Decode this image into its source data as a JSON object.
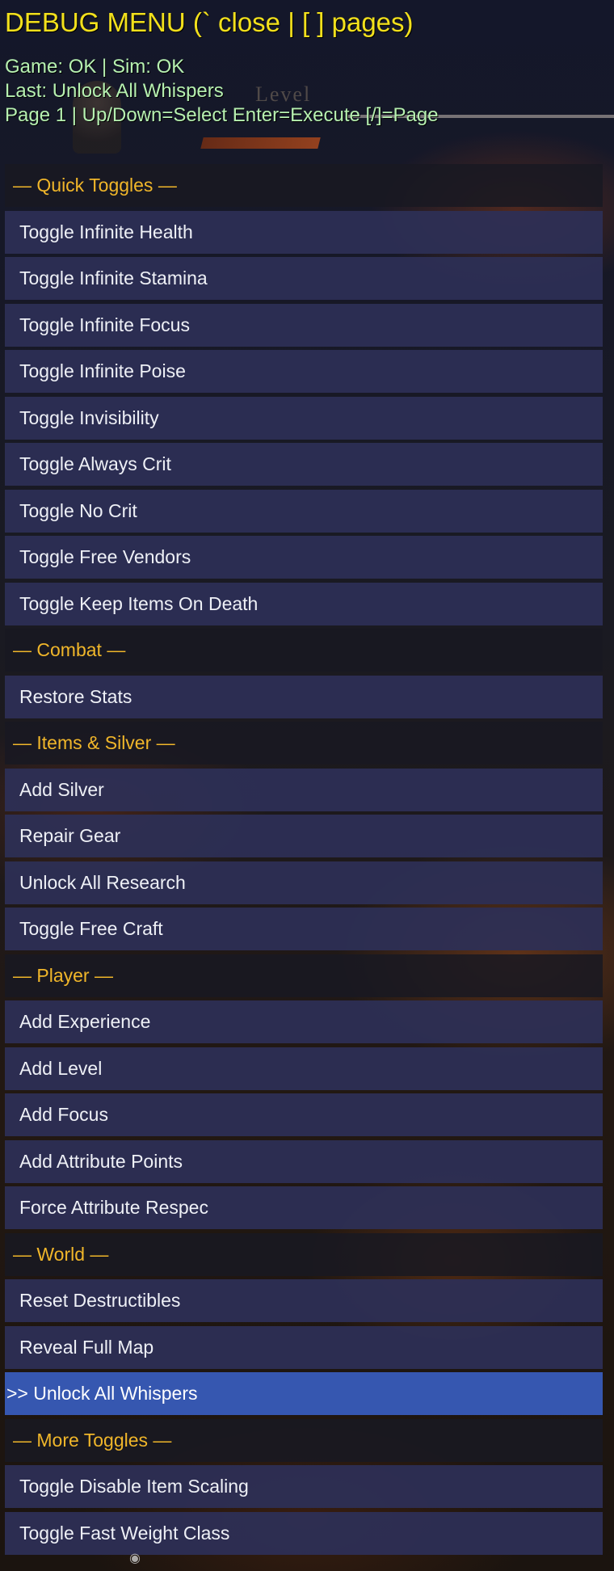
{
  "header": {
    "title": "DEBUG MENU (` close | [ ] pages)",
    "status": "Game: OK | Sim: OK",
    "last": "Last: Unlock All Whispers",
    "page_help": "Page 1 | Up/Down=Select  Enter=Execute  [/]=Page"
  },
  "background": {
    "level_text": "Level",
    "scroll_icon": "eye-icon"
  },
  "colors": {
    "title": "#f2e01c",
    "status": "#b6f0b0",
    "section": "#f0b62a",
    "item_bg": "#2d2f56",
    "selected_bg": "#3657b0"
  },
  "menu": {
    "items": [
      {
        "type": "section",
        "label": "— Quick Toggles —"
      },
      {
        "type": "item",
        "label": "Toggle Infinite Health"
      },
      {
        "type": "item",
        "label": "Toggle Infinite Stamina"
      },
      {
        "type": "item",
        "label": "Toggle Infinite Focus"
      },
      {
        "type": "item",
        "label": "Toggle Infinite Poise"
      },
      {
        "type": "item",
        "label": "Toggle Invisibility"
      },
      {
        "type": "item",
        "label": "Toggle Always Crit"
      },
      {
        "type": "item",
        "label": "Toggle No Crit"
      },
      {
        "type": "item",
        "label": "Toggle Free Vendors"
      },
      {
        "type": "item",
        "label": "Toggle Keep Items On Death"
      },
      {
        "type": "section",
        "label": "— Combat —"
      },
      {
        "type": "item",
        "label": "Restore Stats"
      },
      {
        "type": "section",
        "label": "— Items & Silver —"
      },
      {
        "type": "item",
        "label": "Add Silver"
      },
      {
        "type": "item",
        "label": "Repair Gear"
      },
      {
        "type": "item",
        "label": "Unlock All Research"
      },
      {
        "type": "item",
        "label": "Toggle Free Craft"
      },
      {
        "type": "section",
        "label": "— Player —"
      },
      {
        "type": "item",
        "label": "Add Experience"
      },
      {
        "type": "item",
        "label": "Add Level"
      },
      {
        "type": "item",
        "label": "Add Focus"
      },
      {
        "type": "item",
        "label": "Add Attribute Points"
      },
      {
        "type": "item",
        "label": "Force Attribute Respec"
      },
      {
        "type": "section",
        "label": "— World —"
      },
      {
        "type": "item",
        "label": "Reset Destructibles"
      },
      {
        "type": "item",
        "label": "Reveal Full Map"
      },
      {
        "type": "item",
        "label": ">> Unlock All Whispers",
        "selected": true
      },
      {
        "type": "section",
        "label": "— More Toggles —"
      },
      {
        "type": "item",
        "label": "Toggle Disable Item Scaling"
      },
      {
        "type": "item",
        "label": "Toggle Fast Weight Class"
      }
    ]
  }
}
